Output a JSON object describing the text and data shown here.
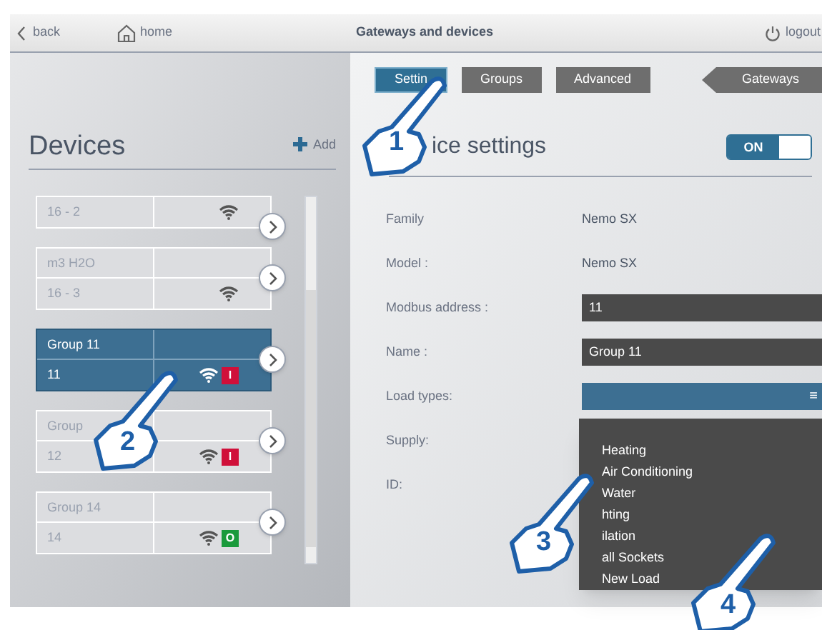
{
  "header": {
    "back": "back",
    "home": "home",
    "title": "Gateways and devices",
    "logout": "logout"
  },
  "tabs": [
    {
      "label": "Settin",
      "selected": true
    },
    {
      "label": "Groups",
      "selected": false
    },
    {
      "label": "Advanced",
      "selected": false
    }
  ],
  "gateways_button": "Gateways",
  "devices": {
    "title": "Devices",
    "add": "Add",
    "items": [
      {
        "id": "16 - 2",
        "selected": false
      },
      {
        "label": "m3 H2O",
        "id": "16 - 3",
        "selected": false
      },
      {
        "label": "Group 11",
        "id": "11",
        "selected": true,
        "status": {
          "text": "I",
          "color": "#d0103a"
        }
      },
      {
        "label": "Group",
        "id": "12",
        "selected": false,
        "status": {
          "text": "I",
          "color": "#d0103a"
        }
      },
      {
        "label": "Group 14",
        "id": "14",
        "selected": false,
        "status": {
          "text": "O",
          "color": "#1a9a3c"
        }
      }
    ]
  },
  "settings": {
    "title": "ice settings",
    "toggle": {
      "label": "ON",
      "on": true
    },
    "fields": [
      {
        "kind": "text",
        "label": "Family",
        "value": "Nemo SX"
      },
      {
        "kind": "text",
        "label": "Model :",
        "value": "Nemo SX"
      },
      {
        "kind": "input",
        "label": "Modbus address :",
        "value": "11"
      },
      {
        "kind": "input",
        "label": "Name :",
        "value": "Group 11"
      },
      {
        "kind": "select",
        "label": "Load types:",
        "icon": "≡"
      },
      {
        "kind": "blank",
        "label": "Supply:"
      },
      {
        "kind": "blank",
        "label": "ID:"
      }
    ],
    "dropdown": [
      "Heating",
      "Air Conditioning",
      "Water",
      "hting",
      "ilation",
      "all Sockets",
      "New Load"
    ]
  },
  "callouts": [
    "1",
    "2",
    "3",
    "4"
  ]
}
